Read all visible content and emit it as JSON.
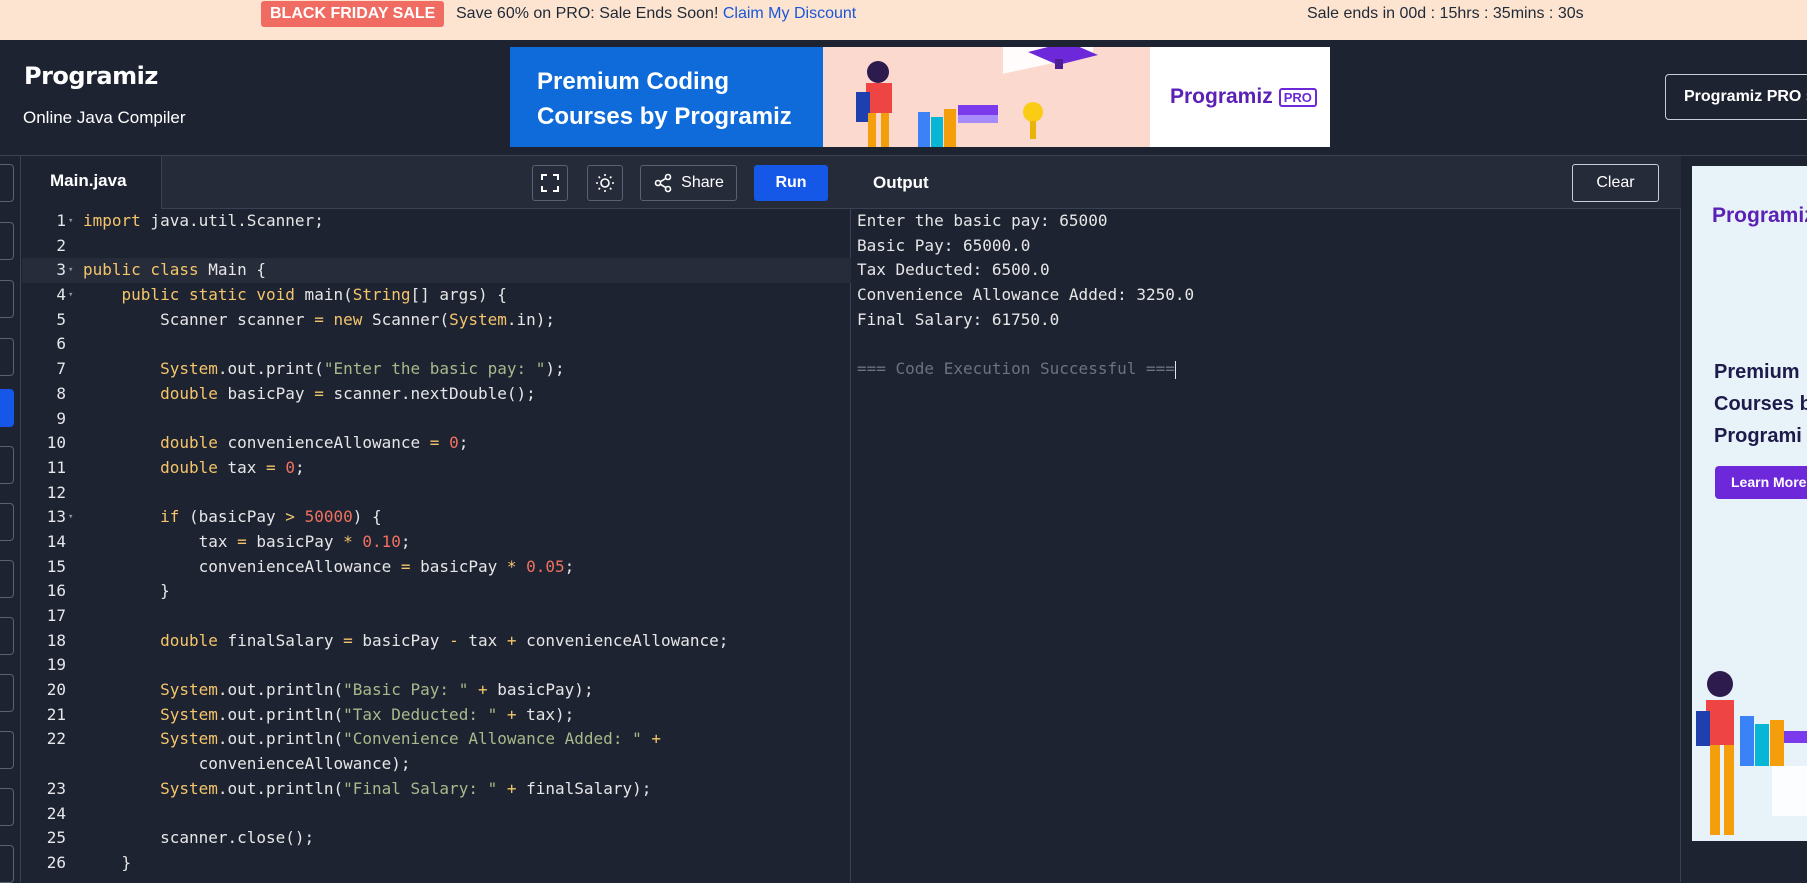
{
  "promo": {
    "badge": "BLACK FRIDAY SALE",
    "text": "Save 60% on PRO: Sale Ends Soon!",
    "link": "Claim My Discount",
    "timer": "Sale ends in 00d : 15hrs : 35mins : 30s"
  },
  "header": {
    "logo": "Programiz",
    "subtitle": "Online Java Compiler",
    "banner_line1": "Premium Coding",
    "banner_line2": "Courses by Programiz",
    "banner_logo": "Programiz",
    "banner_pro": "PRO",
    "pro_button": "Programiz PRO"
  },
  "editor": {
    "tab": "Main.java",
    "share_label": "Share",
    "run_label": "Run",
    "lines": [
      {
        "n": "1"
      },
      {
        "n": "2"
      },
      {
        "n": "3"
      },
      {
        "n": "4"
      },
      {
        "n": "5"
      },
      {
        "n": "6"
      },
      {
        "n": "7"
      },
      {
        "n": "8"
      },
      {
        "n": "9"
      },
      {
        "n": "10"
      },
      {
        "n": "11"
      },
      {
        "n": "12"
      },
      {
        "n": "13"
      },
      {
        "n": "14"
      },
      {
        "n": "15"
      },
      {
        "n": "16"
      },
      {
        "n": "17"
      },
      {
        "n": "18"
      },
      {
        "n": "19"
      },
      {
        "n": "20"
      },
      {
        "n": "21"
      },
      {
        "n": "22"
      },
      {
        "n": ""
      },
      {
        "n": "23"
      },
      {
        "n": "24"
      },
      {
        "n": "25"
      },
      {
        "n": "26"
      }
    ]
  },
  "output": {
    "title": "Output",
    "clear_label": "Clear",
    "lines": [
      "Enter the basic pay: 65000",
      "Basic Pay: 65000.0",
      "Tax Deducted: 6500.0",
      "Convenience Allowance Added: 3250.0",
      "Final Salary: 61750.0",
      "",
      "=== Code Execution Successful ==="
    ]
  },
  "right_ad": {
    "logo": "Programiz",
    "heading1": "Premium",
    "heading2": "Courses b",
    "heading3": "Programi",
    "button": "Learn More"
  },
  "colors": {
    "accent": "#1557e6",
    "background": "#1d2331",
    "promo_bg": "#fde4d0",
    "sale_badge": "#f06c62"
  }
}
